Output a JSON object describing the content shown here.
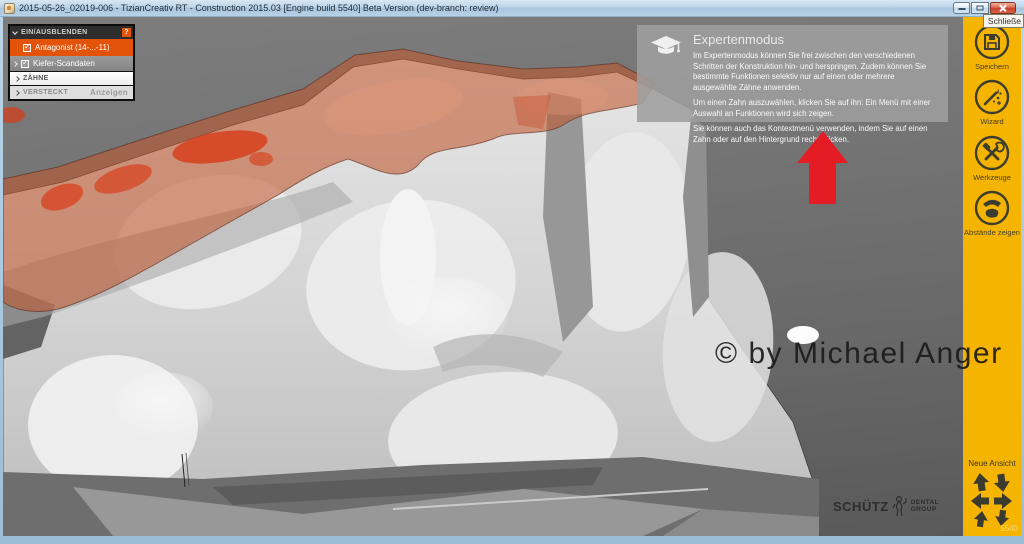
{
  "window": {
    "title": "2015-05-26_02019-006 - TizianCreativ RT - Construction 2015.03 [Engine build 5540] Beta Version (dev-branch: review)",
    "close_tooltip": "Schließe"
  },
  "layers_panel": {
    "header_label": "EIN/AUSBLENDEN",
    "help_label": "?",
    "rows": [
      {
        "label": "Antagonist (14-...-11)",
        "checked": true,
        "selected": true
      },
      {
        "label": "Kiefer-Scandaten",
        "checked": true,
        "expandable": true
      },
      {
        "label": "ZÄHNE"
      },
      {
        "label": "VERSTECKT",
        "action_label": "Anzeigen"
      }
    ]
  },
  "info_box": {
    "title": "Expertenmodus",
    "paragraphs": [
      "Im Expertenmodus können Sie frei zwischen den verschiedenen Schritten der Konstruktion hin- und herspringen. Zudem können Sie bestimmte Funktionen selektiv nur auf einen oder mehrere ausgewählte Zähne anwenden.",
      "Um einen Zahn auszuwählen, klicken Sie auf ihn: Ein Menü mit einer Auswahl an Funktionen wird sich zeigen.",
      "Sie können auch das Kontextmenü verwenden, indem Sie auf einen Zahn oder auf den Hintergrund rechtsklicken."
    ]
  },
  "sidebar": {
    "buttons": [
      {
        "label": "Speichern",
        "icon": "save-icon"
      },
      {
        "label": "Wizard",
        "icon": "magic-wand-icon"
      },
      {
        "label": "Werkzeuge",
        "icon": "tools-icon"
      },
      {
        "label": "Abstände zeigen",
        "icon": "distance-icon"
      }
    ],
    "new_view_label": "Neue Ansicht",
    "build_number": "5540"
  },
  "viewport": {
    "watermark": "© by Michael Anger",
    "logo": {
      "brand": "SCHÜTZ",
      "group_line1": "DENTAL",
      "group_line2": "GROUP"
    }
  },
  "colors": {
    "sidebar_yellow": "#f4b400",
    "selection_orange": "#e4530a",
    "arrow_red": "#e41d25",
    "antagonist_overlay": "rgba(192,88,48,0.58)"
  }
}
